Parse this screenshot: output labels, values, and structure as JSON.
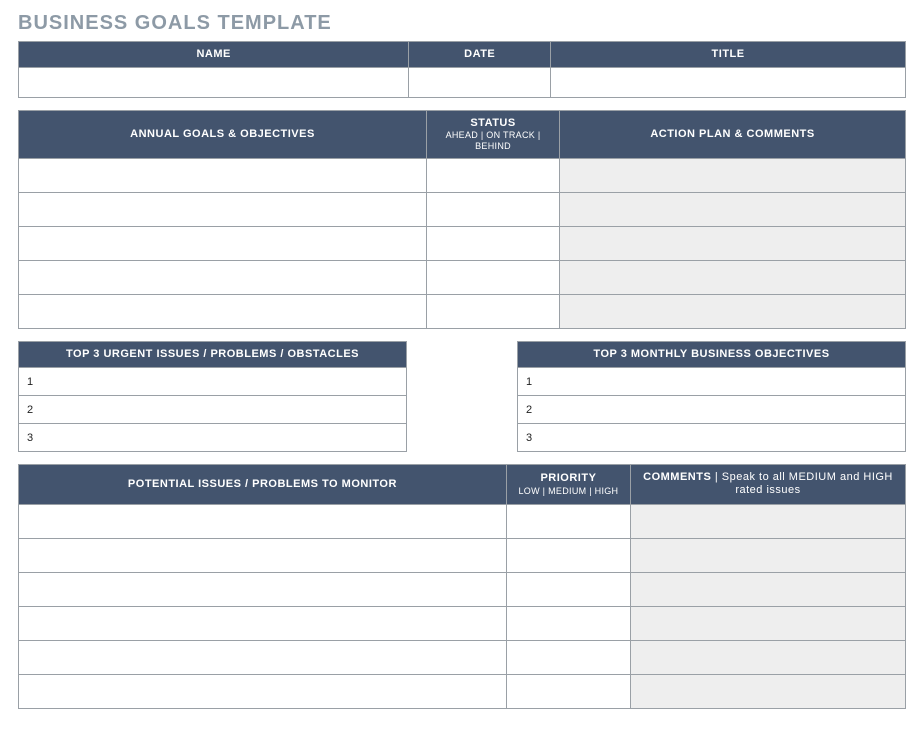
{
  "title": "BUSINESS GOALS TEMPLATE",
  "info_header": {
    "name": "NAME",
    "date": "DATE",
    "title": "TITLE"
  },
  "annual": {
    "col1": "ANNUAL GOALS & OBJECTIVES",
    "col2": "STATUS",
    "col2_sub": "AHEAD | ON TRACK | BEHIND",
    "col3": "ACTION PLAN & COMMENTS"
  },
  "urgent": {
    "header": "TOP 3 URGENT ISSUES / PROBLEMS / OBSTACLES",
    "rows": [
      "1",
      "2",
      "3"
    ]
  },
  "monthly": {
    "header": "TOP 3 MONTHLY BUSINESS OBJECTIVES",
    "rows": [
      "1",
      "2",
      "3"
    ]
  },
  "potential": {
    "col1": "POTENTIAL ISSUES / PROBLEMS TO MONITOR",
    "col2": "PRIORITY",
    "col2_sub": "LOW | MEDIUM | HIGH",
    "col3": "COMMENTS | Speak to all MEDIUM and HIGH rated issues"
  }
}
